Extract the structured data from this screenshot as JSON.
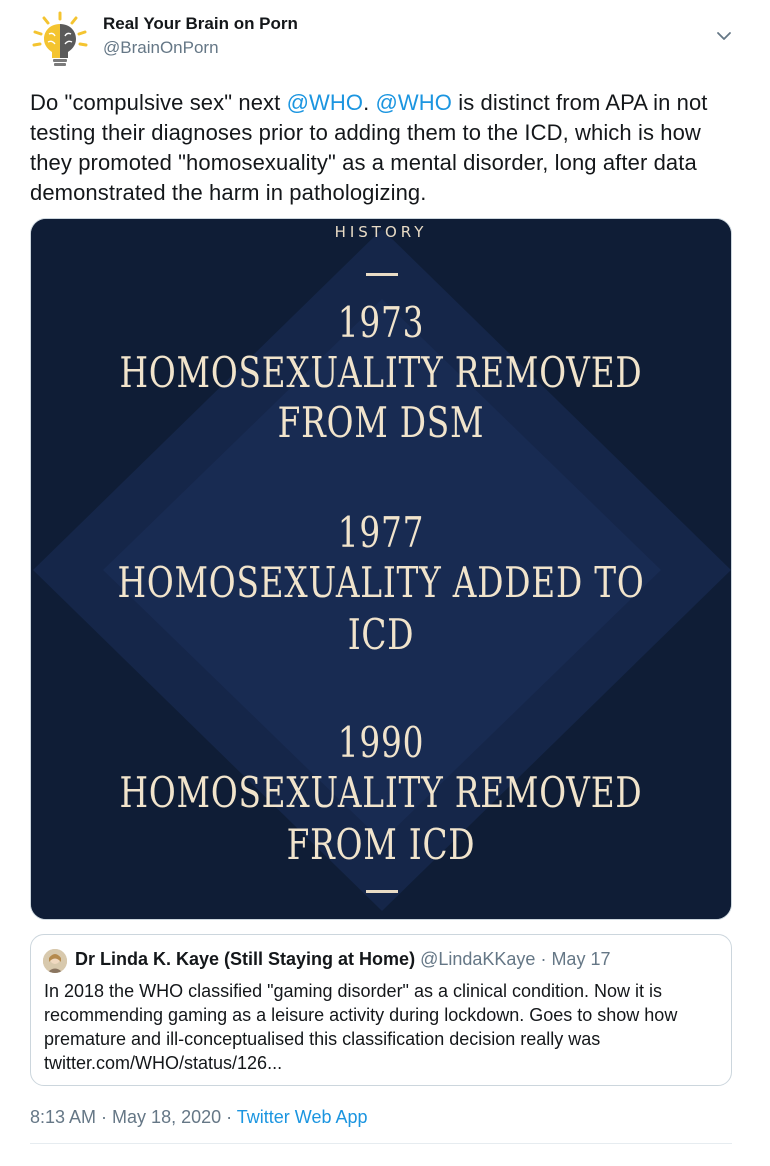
{
  "author": {
    "display_name": "Real Your Brain on Porn",
    "handle": "@BrainOnPorn"
  },
  "tweet": {
    "text_part1": "Do \"compulsive sex\" next ",
    "mention1": "@WHO",
    "text_part2": ". ",
    "mention2": "@WHO",
    "text_part3": " is distinct from APA in not testing their diagnoses prior to adding them to the ICD, which is how they promoted \"homosexuality\" as a mental disorder, long after data demonstrated the harm in pathologizing."
  },
  "image": {
    "heading": "HISTORY",
    "events": [
      {
        "year": "1973",
        "line1": "HOMOSEXUALITY REMOVED",
        "line2": "FROM DSM"
      },
      {
        "year": "1977",
        "line1": "HOMOSEXUALITY ADDED TO",
        "line2": "ICD"
      },
      {
        "year": "1990",
        "line1": "HOMOSEXUALITY REMOVED",
        "line2": "FROM ICD"
      }
    ]
  },
  "quote": {
    "name": "Dr Linda K. Kaye (Still Staying at Home)",
    "handle": "@LindaKKaye",
    "separator": " · ",
    "date": "May 17",
    "text": "In 2018 the WHO classified \"gaming disorder\" as a clinical condition. Now it is recommending gaming as a leisure activity during lockdown. Goes to show how premature and ill-conceptualised this classification decision really was twitter.com/WHO/status/126..."
  },
  "meta": {
    "time": "8:13 AM",
    "sep1": " · ",
    "date": "May 18, 2020",
    "sep2": " · ",
    "source": "Twitter Web App"
  },
  "colors": {
    "link": "#1b95e0",
    "secondary_text": "#657786",
    "image_bg": "#0f1d36",
    "image_text": "#f1e4cc"
  },
  "icons": {
    "avatar": "brain-lightbulb-icon",
    "menu": "chevron-down-icon"
  }
}
